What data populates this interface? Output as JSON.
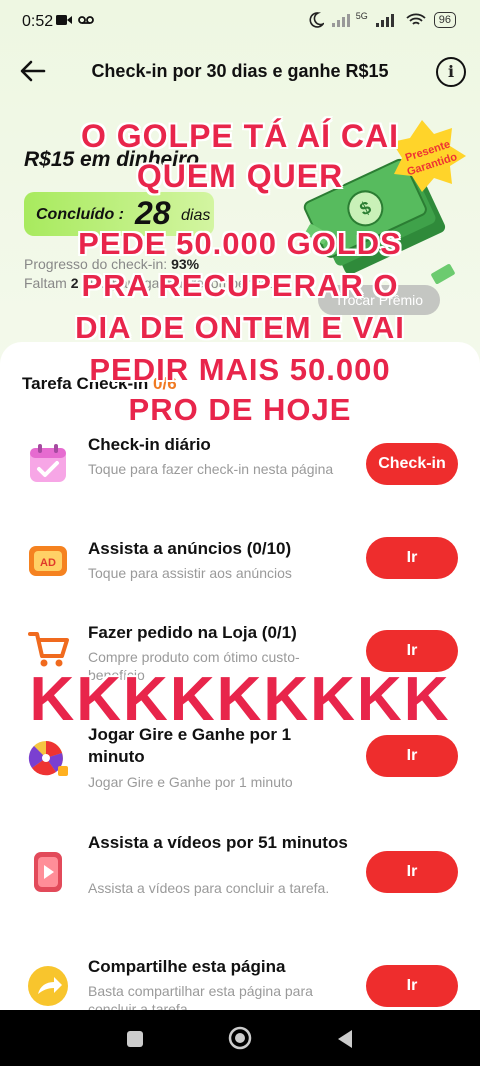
{
  "status": {
    "time": "0:52",
    "network": "5G",
    "battery": "96"
  },
  "header": {
    "title": "Check-in por 30 dias e ganhe R$15"
  },
  "reward": {
    "title": "R$15 em dinheiro",
    "done_label": "Concluído :",
    "done_days": "28",
    "done_unit": "dias",
    "progress_label": "Progresso do check-in:",
    "progress_value": "93%",
    "remaining_prefix": "Faltam",
    "remaining_num": "2",
    "remaining_rest": "dias para ganhar recompensas",
    "exchange_button": "Trocar Prêmio",
    "badge": "Presente Garantido"
  },
  "tasks_header": {
    "label": "Tarefa Check-in",
    "count": "0/6"
  },
  "tasks": [
    {
      "name": "Check-in diário",
      "desc": "Toque para fazer check-in nesta página",
      "button": "Check-in"
    },
    {
      "name": "Assista a anúncios  (0/10)",
      "desc": "Toque para assistir aos anúncios",
      "button": "Ir"
    },
    {
      "name": "Fazer pedido na Loja  (0/1)",
      "desc": "Compre produto com ótimo custo-benefício",
      "button": "Ir"
    },
    {
      "name": "Jogar Gire e Ganhe por 1 minuto",
      "desc": "Jogar Gire e Ganhe por 1 minuto",
      "button": "Ir"
    },
    {
      "name": "Assista a vídeos por 51 minutos",
      "desc": "Assista a vídeos para concluir a tarefa.",
      "button": "Ir"
    },
    {
      "name": "Compartilhe esta página",
      "desc": "Basta compartilhar esta página para concluir a tarefa",
      "button": "Ir"
    }
  ],
  "overlay_text": {
    "lines": [
      "O GOLPE TÁ AÍ CAI",
      "QUEM QUER",
      "PEDE 50.000 GOLDS",
      "PRA RECUPERAR O",
      "DIA DE ONTEM E VAI",
      "PEDIR MAIS 50.000",
      "PRO DE HOJE"
    ],
    "laugh": "KKKKKKKKK"
  },
  "colors": {
    "accent": "#ee2d2d",
    "overlay": "#e8254b",
    "done_pill": "#a8ea5e"
  }
}
